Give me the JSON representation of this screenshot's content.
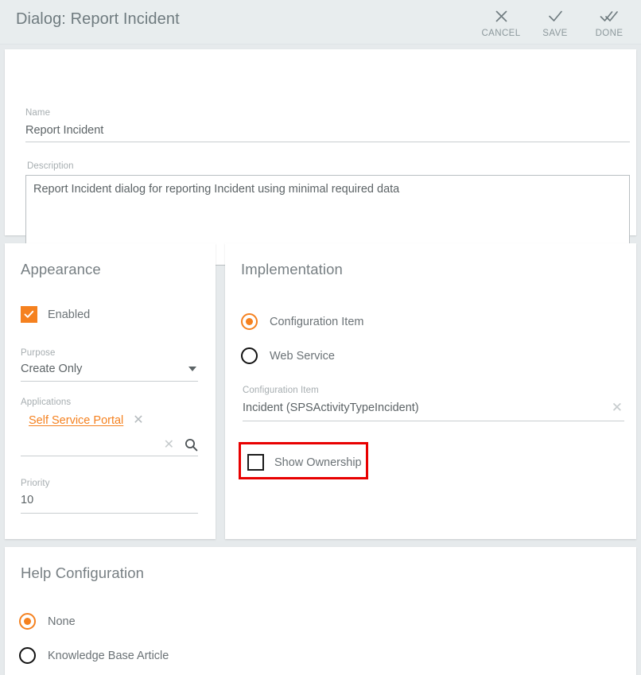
{
  "header": {
    "title": "Dialog: Report Incident",
    "actions": [
      {
        "label": "CANCEL",
        "icon": "close-icon"
      },
      {
        "label": "SAVE",
        "icon": "check-icon"
      },
      {
        "label": "DONE",
        "icon": "double-check-icon"
      }
    ]
  },
  "basic": {
    "name": {
      "label": "Name",
      "value": "Report Incident"
    },
    "description": {
      "label": "Description",
      "value": "Report Incident dialog for reporting Incident using minimal required data"
    }
  },
  "appearance": {
    "title": "Appearance",
    "enabled": {
      "label": "Enabled",
      "checked": true
    },
    "purpose": {
      "label": "Purpose",
      "value": "Create Only",
      "icon": "chevron-down-icon"
    },
    "applications": {
      "label": "Applications",
      "chips": [
        {
          "label": "Self Service Portal",
          "remove_icon": "close-icon"
        }
      ],
      "search": {
        "value": "",
        "placeholder": "",
        "clear_icon": "close-icon",
        "search_icon": "search-icon"
      }
    },
    "priority": {
      "label": "Priority",
      "value": "10"
    }
  },
  "implementation": {
    "title": "Implementation",
    "type_options": [
      {
        "label": "Configuration Item",
        "selected": true
      },
      {
        "label": "Web Service",
        "selected": false
      }
    ],
    "configuration_item": {
      "label": "Configuration Item",
      "value": "Incident (SPSActivityTypeIncident)",
      "clear_icon": "close-icon"
    },
    "show_ownership": {
      "label": "Show Ownership",
      "checked": false,
      "highlighted": true
    }
  },
  "help": {
    "title": "Help Configuration",
    "options": [
      {
        "label": "None",
        "selected": true
      },
      {
        "label": "Knowledge Base Article",
        "selected": false
      }
    ]
  },
  "colors": {
    "accent": "#f5811f",
    "highlight": "#e8000a",
    "page_bg": "#e6eaec",
    "header_bg": "#e8edee",
    "text": "#6b7276",
    "label": "#a6adb0"
  }
}
